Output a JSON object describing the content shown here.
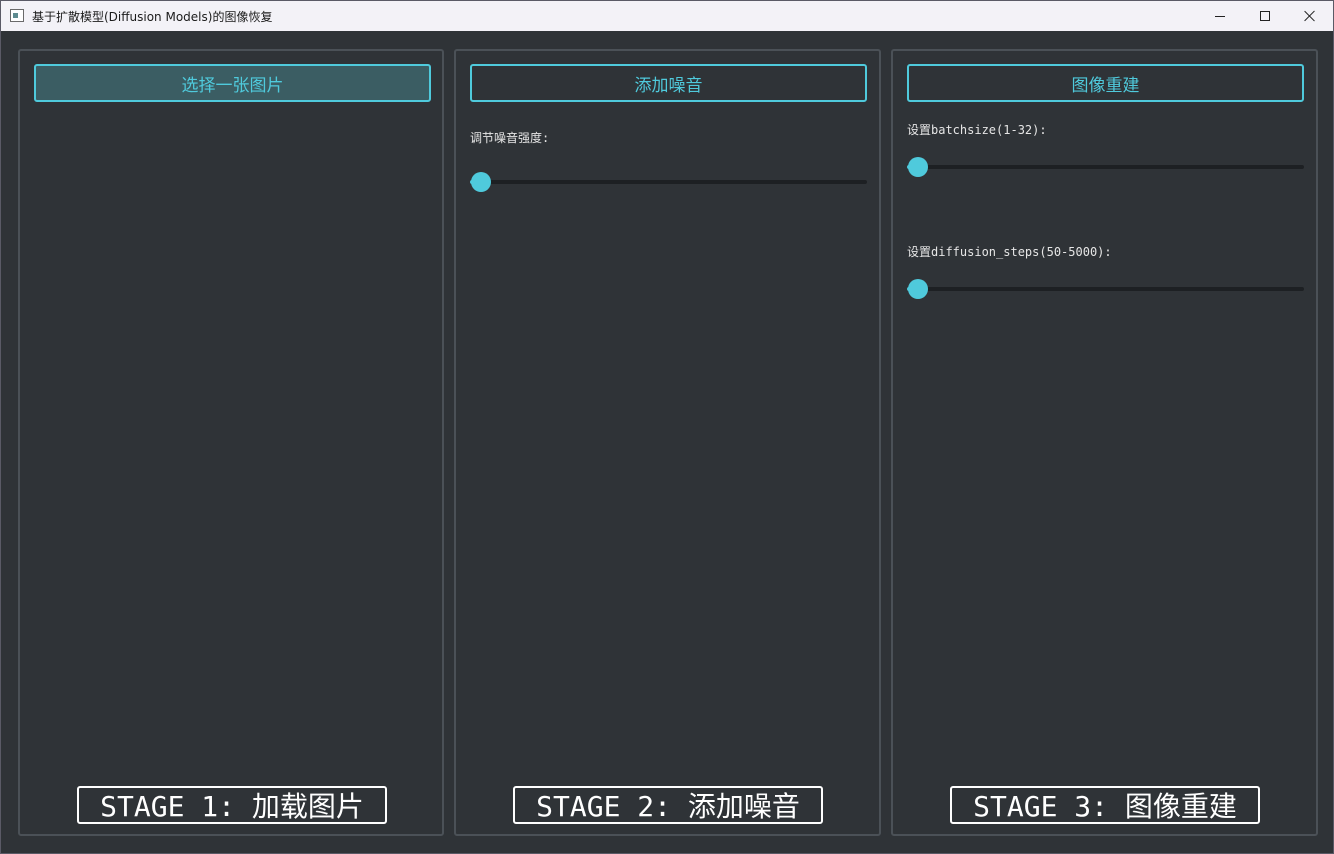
{
  "window": {
    "title": "基于扩散模型(Diffusion Models)的图像恢复"
  },
  "colors": {
    "accent": "#4fcadc",
    "background": "#2f3337",
    "panel_border": "#4b5157",
    "stage_text": "#ffffff"
  },
  "panels": [
    {
      "button_label": "选择一张图片",
      "stage_label": "STAGE 1: 加载图片"
    },
    {
      "button_label": "添加噪音",
      "slider_label": "调节噪音强度:",
      "slider_value": 0,
      "stage_label": "STAGE 2: 添加噪音"
    },
    {
      "button_label": "图像重建",
      "batch_label": "设置batchsize(1-32):",
      "batch_value": 0,
      "steps_label": "设置diffusion_steps(50-5000):",
      "steps_value": 0,
      "stage_label": "STAGE 3: 图像重建"
    }
  ]
}
